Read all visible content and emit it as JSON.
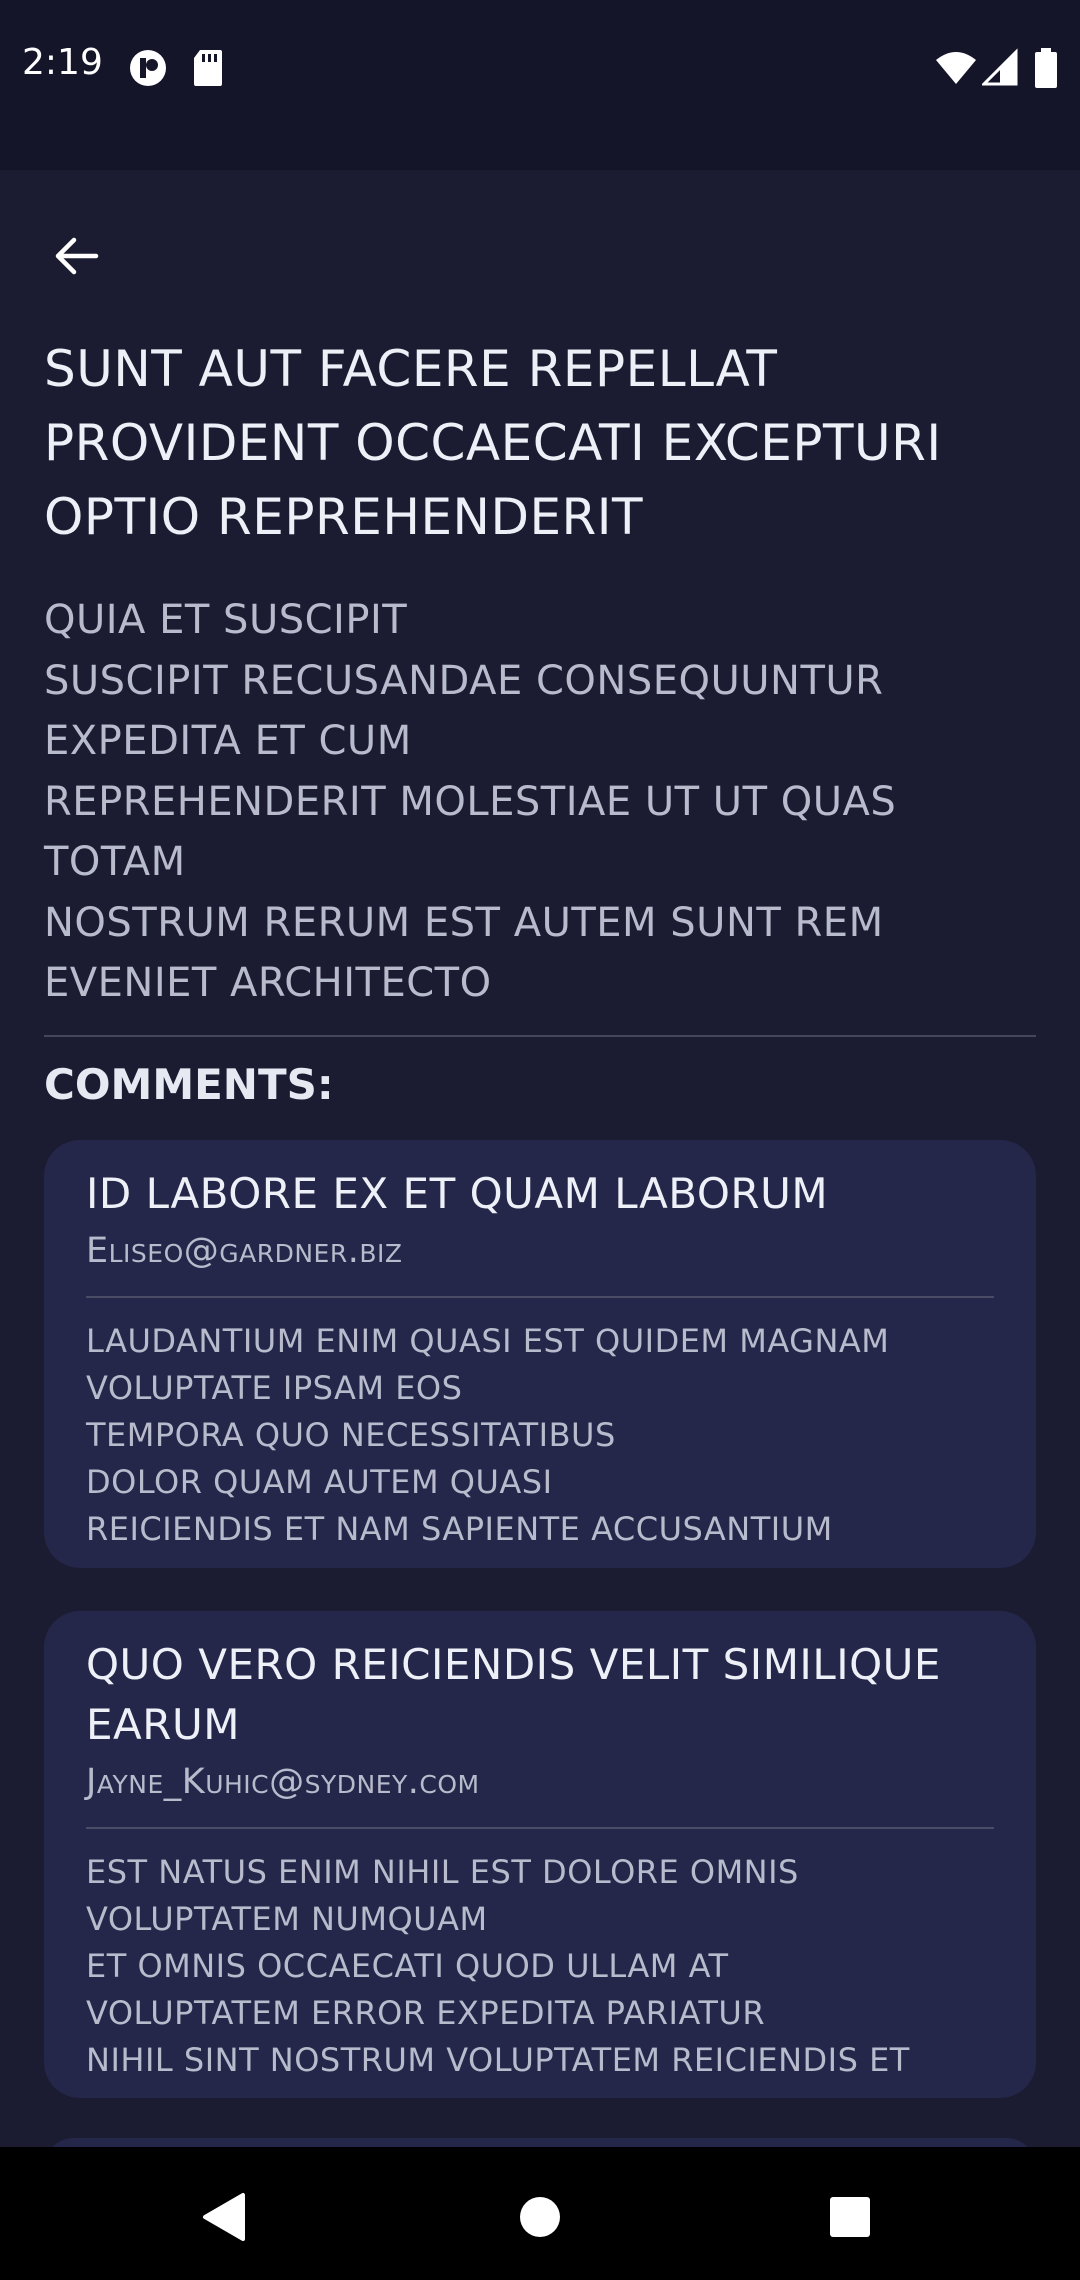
{
  "status_bar": {
    "time": "2:19"
  },
  "post": {
    "title": "sunt aut facere repellat provident occaecati excepturi optio reprehenderit",
    "body": "quia et suscipit\nsuscipit recusandae consequuntur expedita et cum\nreprehenderit molestiae ut ut quas totam\nnostrum rerum est autem sunt rem eveniet architecto"
  },
  "comments_heading": "Comments:",
  "comments": [
    {
      "name": "id labore ex et quam laborum",
      "email": "Eliseo@gardner.biz",
      "body": "laudantium enim quasi est quidem magnam voluptate ipsam eos\ntempora quo necessitatibus\ndolor quam autem quasi\nreiciendis et nam sapiente accusantium"
    },
    {
      "name": "quo vero reiciendis velit similique earum",
      "email": "Jayne_Kuhic@sydney.com",
      "body": "est natus enim nihil est dolore omnis voluptatem numquam\net omnis occaecati quod ullam at\nvoluptatem error expedita pariatur\nnihil sint nostrum voluptatem reiciendis et"
    }
  ],
  "colors": {
    "background": "#1b1c31",
    "card": "#25274a",
    "text_primary": "#eef0f7",
    "text_secondary": "#b8bbcc"
  },
  "icons": {
    "back": "arrow-back-icon",
    "nav_back": "triangle-back-icon",
    "nav_home": "circle-home-icon",
    "nav_recents": "square-recents-icon"
  }
}
